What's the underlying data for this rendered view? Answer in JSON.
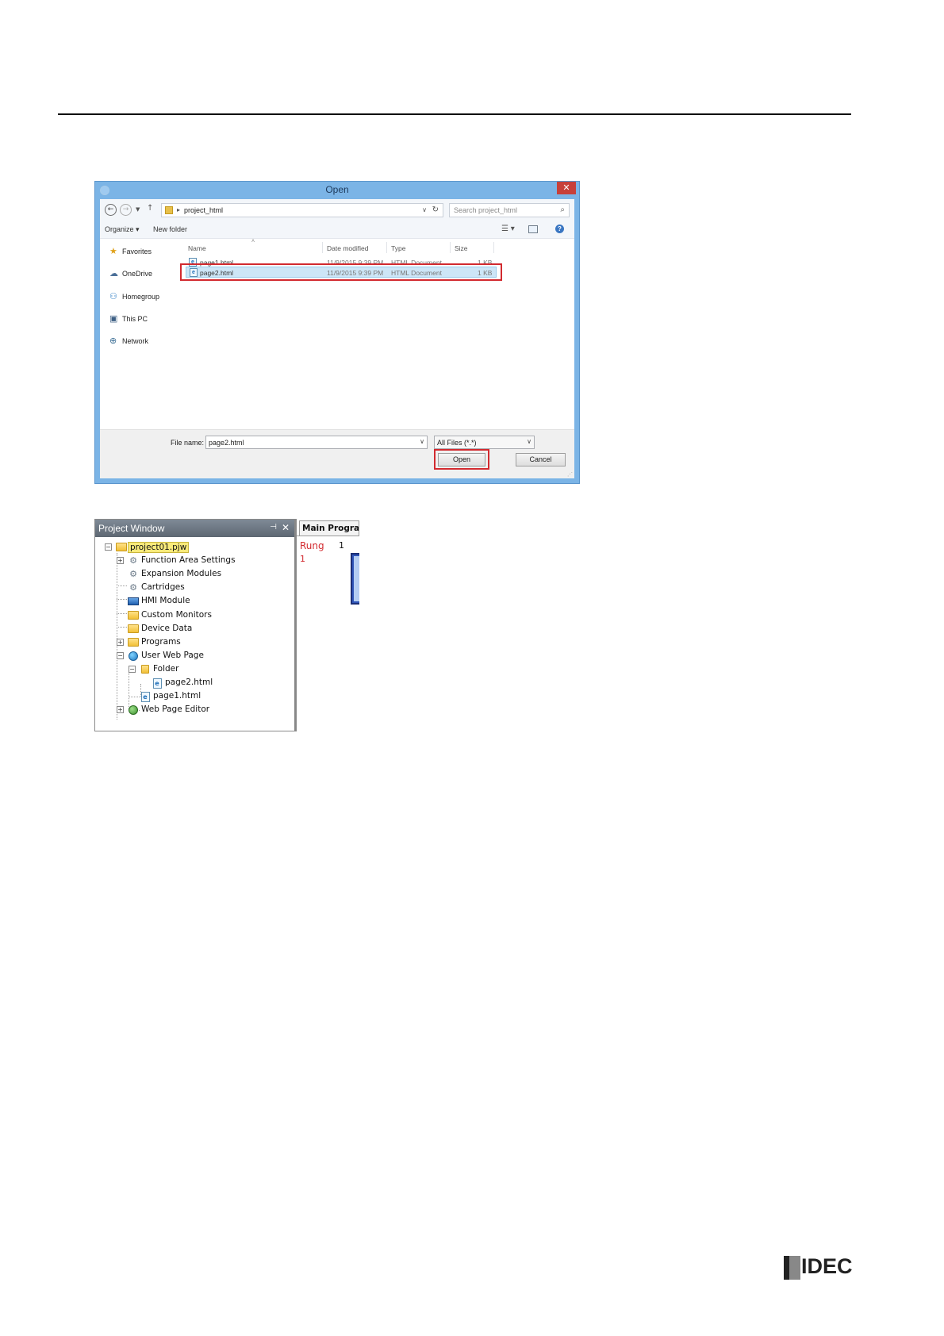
{
  "dialog": {
    "title": "Open",
    "close_glyph": "✕",
    "address": {
      "path": "project_html",
      "separator": "▸"
    },
    "search_placeholder": "Search project_html",
    "toolbar": {
      "organize": "Organize ▾",
      "new_folder": "New folder"
    },
    "nav_pane": [
      {
        "label": "Favorites",
        "icon": "star-icon"
      },
      {
        "label": "OneDrive",
        "icon": "cloud-icon"
      },
      {
        "label": "Homegroup",
        "icon": "homegroup-icon"
      },
      {
        "label": "This PC",
        "icon": "computer-icon"
      },
      {
        "label": "Network",
        "icon": "network-icon"
      }
    ],
    "columns": {
      "name": "Name",
      "date": "Date modified",
      "type": "Type",
      "size": "Size"
    },
    "files": [
      {
        "name": "page1.html",
        "date": "11/9/2015 9:39 PM",
        "type": "HTML Document",
        "size": "1 KB",
        "selected": false
      },
      {
        "name": "page2.html",
        "date": "11/9/2015 9:39 PM",
        "type": "HTML Document",
        "size": "1 KB",
        "selected": true
      }
    ],
    "file_name_label": "File name:",
    "file_name_value": "page2.html",
    "file_type_value": "All Files (*.*)",
    "open_button": "Open",
    "cancel_button": "Cancel",
    "highlight_color": "#d22a2f"
  },
  "project_window": {
    "title": "Project Window",
    "pin_glyph": "⊣",
    "close_glyph": "✕",
    "tree": {
      "root": "project01.pjw",
      "function_area": "Function Area Settings",
      "expansion": "Expansion Modules",
      "cartridges": "Cartridges",
      "hmi": "HMI Module",
      "custom_monitors": "Custom Monitors",
      "device_data": "Device Data",
      "programs": "Programs",
      "user_web_page": "User Web Page",
      "folder": "Folder",
      "page2": "page2.html",
      "page1": "page1.html",
      "web_page_editor": "Web Page Editor"
    }
  },
  "main_program": {
    "tab": "Main Program",
    "rung_label": "Rung",
    "rung_number": "1",
    "column_number": "1"
  },
  "brand": {
    "logo_text": "IDEC"
  }
}
